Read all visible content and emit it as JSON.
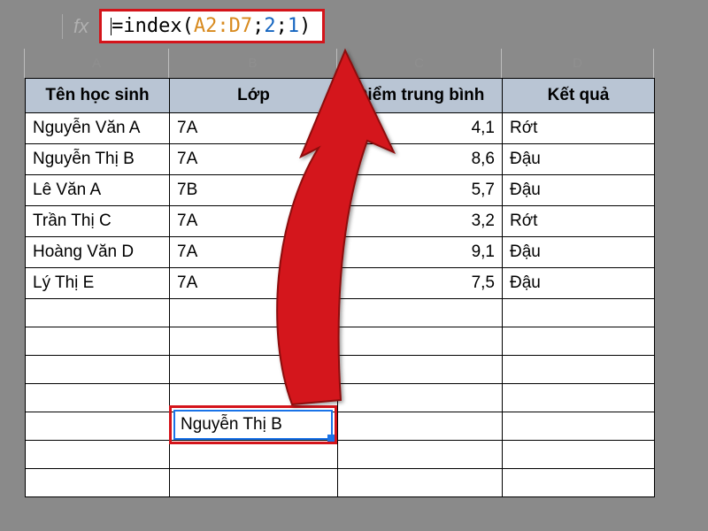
{
  "formula": {
    "prefix": "=index",
    "open": "(",
    "range": "A2:D7",
    "sep1": ";",
    "arg2": "2",
    "sep2": ";",
    "arg3": "1",
    "close": ")"
  },
  "fx_label": "fx",
  "columns": [
    "A",
    "B",
    "C",
    "D"
  ],
  "headers": [
    "Tên học sinh",
    "Lớp",
    "Điểm trung bình",
    "Kết quả"
  ],
  "rows": [
    {
      "name": "Nguyễn Văn A",
      "class": "7A",
      "score": "4,1",
      "result": "Rớt"
    },
    {
      "name": "Nguyễn Thị B",
      "class": "7A",
      "score": "8,6",
      "result": "Đậu"
    },
    {
      "name": "Lê Văn A",
      "class": "7B",
      "score": "5,7",
      "result": "Đậu"
    },
    {
      "name": "Trần Thị C",
      "class": "7A",
      "score": "3,2",
      "result": "Rớt"
    },
    {
      "name": "Hoàng Văn D",
      "class": "7A",
      "score": "9,1",
      "result": "Đậu"
    },
    {
      "name": "Lý Thị E",
      "class": "7A",
      "score": "7,5",
      "result": "Đậu"
    }
  ],
  "result_cell": "Nguyễn Thị B"
}
